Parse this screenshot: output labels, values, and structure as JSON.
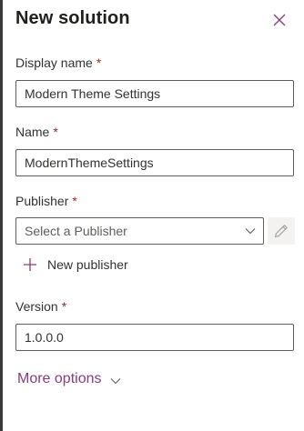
{
  "panel": {
    "title": "New solution",
    "close_icon": "close-icon"
  },
  "form": {
    "display_name": {
      "label": "Display name",
      "required_mark": "*",
      "value": "Modern Theme Settings"
    },
    "name": {
      "label": "Name",
      "required_mark": "*",
      "value": "ModernThemeSettings"
    },
    "publisher": {
      "label": "Publisher",
      "required_mark": "*",
      "placeholder": "Select a Publisher",
      "edit_icon": "pencil-icon",
      "new_publisher_label": "New publisher",
      "new_publisher_icon": "plus-icon"
    },
    "version": {
      "label": "Version",
      "required_mark": "*",
      "value": "1.0.0.0"
    },
    "more_options": {
      "label": "More options",
      "icon": "chevron-down-icon"
    }
  },
  "colors": {
    "accent": "#8a3c7b",
    "required": "#a4262c",
    "border": "#605e5c",
    "text": "#323130"
  }
}
